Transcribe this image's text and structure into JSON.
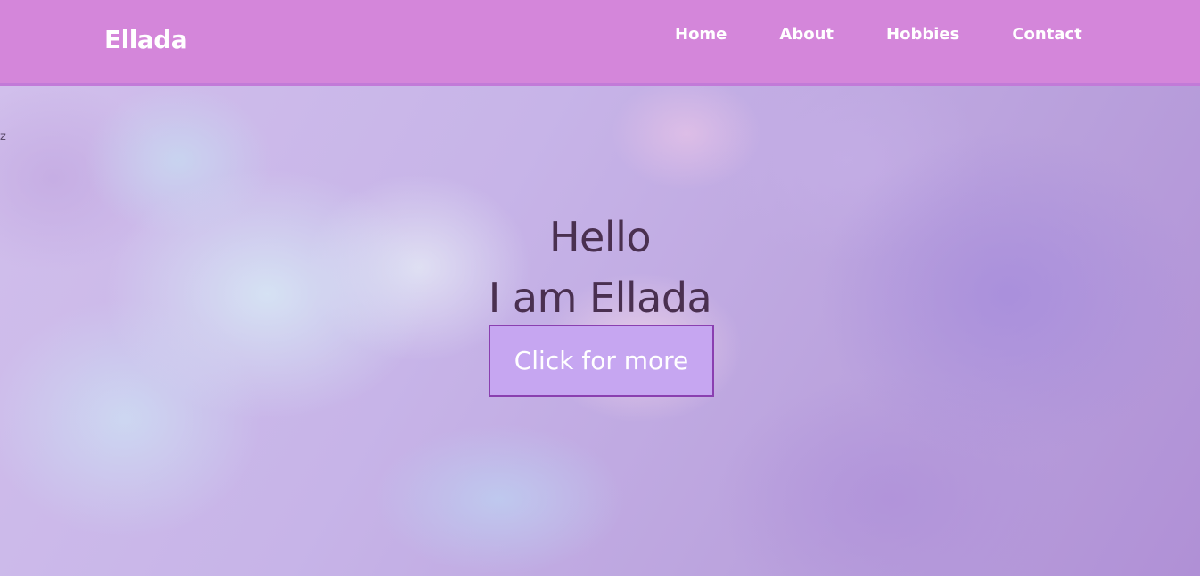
{
  "navbar": {
    "brand": "Ellada",
    "links": [
      {
        "label": "Home"
      },
      {
        "label": "About"
      },
      {
        "label": "Hobbies"
      },
      {
        "label": "Contact"
      }
    ],
    "background_color": "#d486da"
  },
  "stray_text": "z",
  "hero": {
    "line1": "Hello",
    "line2": "I am Ellada",
    "button_label": "Click for more",
    "text_color": "#4a3050",
    "button_color": "#c6a6f1",
    "button_border_color": "#8a3fb0"
  }
}
